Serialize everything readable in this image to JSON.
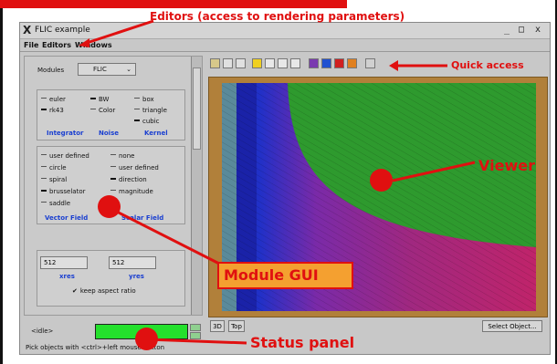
{
  "window": {
    "title": "FLIC example",
    "controls": [
      "_",
      "□",
      "x"
    ]
  },
  "menu": {
    "items": [
      "File",
      "Editors",
      "Windows"
    ]
  },
  "modules": {
    "label": "Modules",
    "selected": "FLIC"
  },
  "groups": {
    "integrator": {
      "title": "Integrator",
      "options": [
        "euler",
        "rk43"
      ],
      "selected": "rk43"
    },
    "noise": {
      "title": "Noise",
      "options": [
        "BW",
        "Color"
      ],
      "selected": "BW"
    },
    "kernel": {
      "title": "Kernel",
      "options": [
        "box",
        "triangle",
        "cubic"
      ],
      "selected": "cubic"
    },
    "vector_field": {
      "title": "Vector Field",
      "options": [
        "user defined",
        "circle",
        "spiral",
        "brusselator",
        "saddle"
      ],
      "selected": "brusselator"
    },
    "scalar_field": {
      "title": "Scalar Field",
      "options": [
        "none",
        "user defined",
        "direction",
        "magnitude"
      ],
      "selected": "direction"
    }
  },
  "resolution": {
    "xres_value": "512",
    "yres_value": "512",
    "xres_label": "xres",
    "yres_label": "yres",
    "keep_aspect": "keep aspect ratio"
  },
  "bottom": {
    "status": "<idle>",
    "hint": "Pick objects with <ctrl>+left mouse button",
    "btn_3d": "3D",
    "btn_top": "Top",
    "select_object": "Select Object..."
  },
  "annotations": {
    "editors": "Editors (access to rendering parameters)",
    "quick_access": "Quick access",
    "viewer": "Viewer",
    "module_gui": "Module GUI",
    "status_panel": "Status panel"
  },
  "colors": {
    "accent_red": "#e01010",
    "callout_orange": "#f4a030",
    "status_green": "#24e02c",
    "label_blue": "#1a3fd0"
  }
}
